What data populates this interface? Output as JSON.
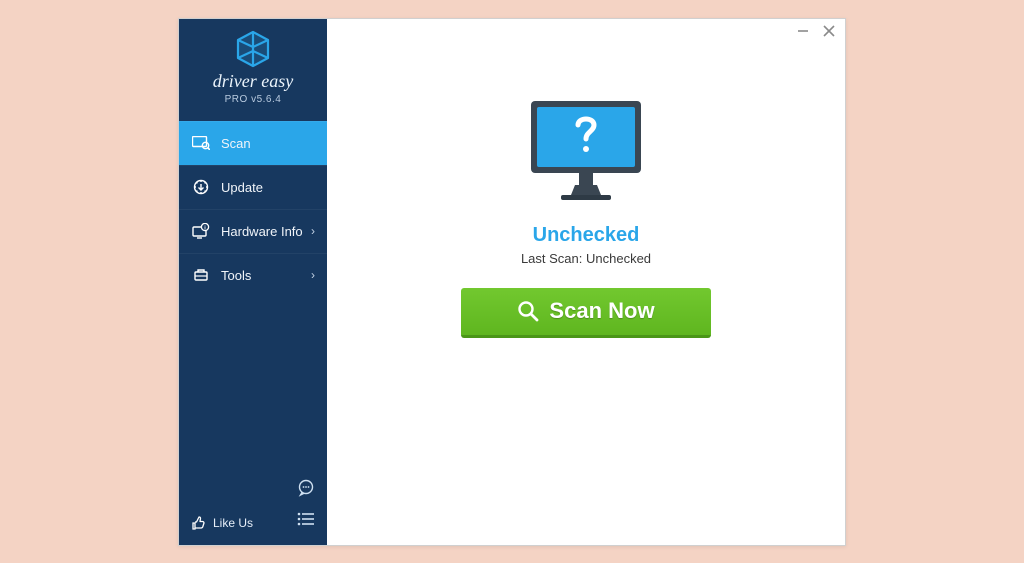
{
  "brand": {
    "name": "driver easy",
    "version": "PRO v5.6.4"
  },
  "sidebar": {
    "items": [
      {
        "label": "Scan",
        "has_sub": false,
        "active": true
      },
      {
        "label": "Update",
        "has_sub": false,
        "active": false
      },
      {
        "label": "Hardware Info",
        "has_sub": true,
        "active": false
      },
      {
        "label": "Tools",
        "has_sub": true,
        "active": false
      }
    ],
    "like_us": "Like Us"
  },
  "main": {
    "status_title": "Unchecked",
    "status_sub": "Last Scan: Unchecked",
    "scan_button": "Scan Now"
  },
  "colors": {
    "accent": "#2aa6e9",
    "sidebar_bg": "#17385f",
    "scan_green": "#65bf22"
  }
}
